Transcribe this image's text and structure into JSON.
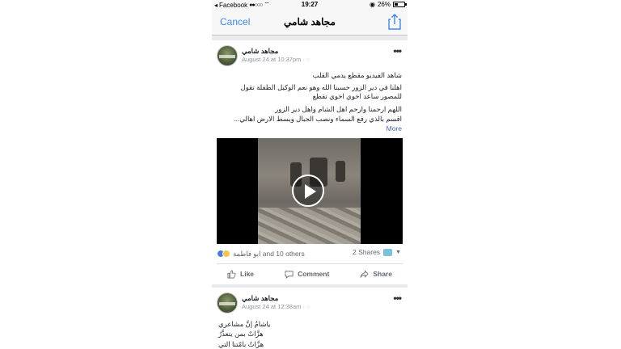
{
  "status_bar": {
    "carrier": "Facebook",
    "signal": "●●○○○",
    "time": "19:27",
    "battery": "26%"
  },
  "nav": {
    "cancel_label": "Cancel",
    "title": "مجاهد شامي"
  },
  "post1": {
    "author": "مجاهد شامي",
    "meta": "August 24 at 10:37pm · ",
    "more": "•••",
    "lines": [
      "شاهد الفيديو مقطع يدمي القلب",
      "اهلنا في دير الزور حسبنا الله وهو نعم الوكيل الطفلة تقول",
      "للمصور ساعد اخوي اخوي تقطع",
      "اللهم ارحمنا وارحم اهل الشام واهل دير الزور",
      "اقسم بالذي رفع السماء ونصب الجبال وبسط الارض اهالي..."
    ],
    "see_more": "More",
    "reactions_text": "ابو فاطمة and 10 others",
    "shares_text": "2 Shares",
    "actions": {
      "like": "Like",
      "comment": "Comment",
      "share": "Share"
    }
  },
  "post2": {
    "author": "مجاهد شامي",
    "meta": "August 24 at 12:38am · ",
    "more": "•••",
    "lines": [
      "ياشامُ إنَّ مشاعري",
      "هزَّاتٌ بمن يتعذَّرُ",
      "هزَّاتٌ بامّتنا التي"
    ]
  },
  "colors": {
    "accent": "#3b88f5",
    "link": "#4267b2",
    "background": "#e9ebee"
  }
}
